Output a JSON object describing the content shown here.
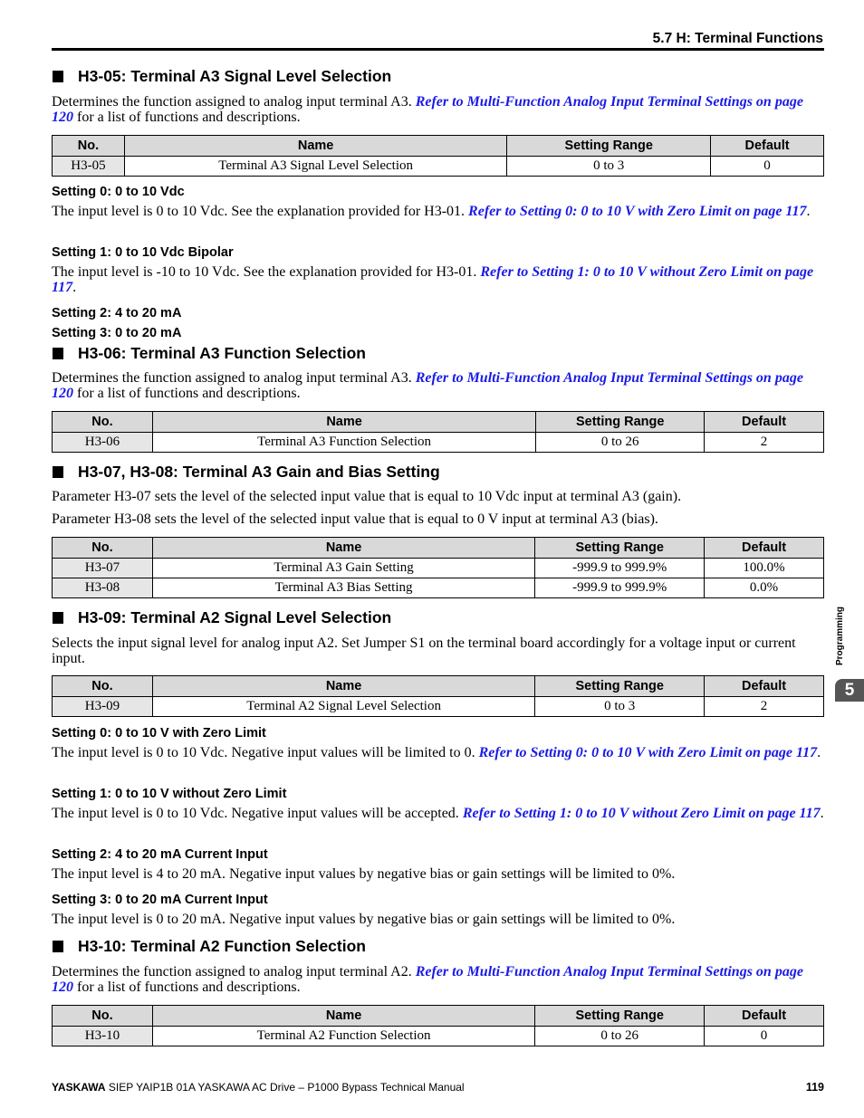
{
  "header": {
    "title": "5.7 H: Terminal Functions"
  },
  "sections": [
    {
      "heading": "H3-05: Terminal A3 Signal Level Selection",
      "intro": {
        "text_before": "Determines the function assigned to analog input terminal A3. ",
        "link": "Refer to Multi-Function Analog Input Terminal Settings on page 120",
        "text_after": " for a list of functions and descriptions."
      },
      "table": {
        "headers": [
          "No.",
          "Name",
          "Setting Range",
          "Default"
        ],
        "rows": [
          [
            "H3-05",
            "Terminal A3 Signal Level Selection",
            "0 to 3",
            "0"
          ]
        ]
      },
      "settings": [
        {
          "title": "Setting 0: 0 to 10 Vdc",
          "text_before": "The input level is 0 to 10 Vdc. See the explanation provided for H3-01. ",
          "link": "Refer to Setting 0: 0 to 10 V with Zero Limit on page 117",
          "text_after": "."
        },
        {
          "title": "Setting 1: 0 to 10 Vdc Bipolar",
          "text_before": "The input level is -10 to 10 Vdc. See the explanation provided for H3-01. ",
          "link": "Refer to Setting 1: 0 to 10 V without Zero Limit on page 117",
          "text_after": "."
        },
        {
          "title": "Setting 2: 4 to 20 mA"
        },
        {
          "title": "Setting 3: 0 to 20 mA"
        }
      ]
    },
    {
      "heading": "H3-06: Terminal A3 Function Selection",
      "intro": {
        "text_before": "Determines the function assigned to analog input terminal A3. ",
        "link": "Refer to Multi-Function Analog Input Terminal Settings on page 120",
        "text_after": " for a list of functions and descriptions."
      },
      "table": {
        "headers": [
          "No.",
          "Name",
          "Setting Range",
          "Default"
        ],
        "rows": [
          [
            "H3-06",
            "Terminal A3 Function Selection",
            "0 to 26",
            "2"
          ]
        ]
      }
    },
    {
      "heading": "H3-07, H3-08: Terminal A3 Gain and Bias Setting",
      "paragraphs": [
        "Parameter H3-07 sets the level of the selected input value that is equal to 10 Vdc input at terminal A3 (gain).",
        "Parameter H3-08 sets the level of the selected input value that is equal to 0 V input at terminal A3 (bias)."
      ],
      "table": {
        "headers": [
          "No.",
          "Name",
          "Setting Range",
          "Default"
        ],
        "rows": [
          [
            "H3-07",
            "Terminal A3 Gain Setting",
            "-999.9 to 999.9%",
            "100.0%"
          ],
          [
            "H3-08",
            "Terminal A3 Bias Setting",
            "-999.9 to 999.9%",
            "0.0%"
          ]
        ]
      }
    },
    {
      "heading": "H3-09: Terminal A2 Signal Level Selection",
      "paragraphs": [
        "Selects the input signal level for analog input A2. Set Jumper S1 on the terminal board accordingly for a voltage input or current input."
      ],
      "table": {
        "headers": [
          "No.",
          "Name",
          "Setting Range",
          "Default"
        ],
        "rows": [
          [
            "H3-09",
            "Terminal A2 Signal Level Selection",
            "0 to 3",
            "2"
          ]
        ]
      },
      "settings": [
        {
          "title": "Setting 0: 0 to 10 V with Zero Limit",
          "text_before": "The input level is 0 to 10 Vdc. Negative input values will be limited to 0. ",
          "link": "Refer to Setting 0: 0 to 10 V with Zero Limit on page 117",
          "text_after": "."
        },
        {
          "title": "Setting 1: 0 to 10 V without Zero Limit",
          "text_before": "The input level is 0 to 10 Vdc. Negative input values will be accepted. ",
          "link": "Refer to Setting 1: 0 to 10 V without Zero Limit on page 117",
          "text_after": "."
        },
        {
          "title": "Setting 2: 4 to 20 mA Current Input",
          "text_before": "The input level is 4 to 20 mA. Negative input values by negative bias or gain settings will be limited to 0%."
        },
        {
          "title": "Setting 3: 0 to 20 mA Current Input",
          "text_before": "The input level is 0 to 20 mA. Negative input values by negative bias or gain settings will be limited to 0%."
        }
      ]
    },
    {
      "heading": "H3-10: Terminal A2 Function Selection",
      "intro": {
        "text_before": "Determines the function assigned to analog input terminal A2. ",
        "link": "Refer to Multi-Function Analog Input Terminal Settings on page 120",
        "text_after": " for a list of functions and descriptions."
      },
      "table": {
        "headers": [
          "No.",
          "Name",
          "Setting Range",
          "Default"
        ],
        "rows": [
          [
            "H3-10",
            "Terminal A2 Function Selection",
            "0 to 26",
            "0"
          ]
        ]
      }
    }
  ],
  "side_tab": {
    "label": "Programming",
    "chapter": "5"
  },
  "footer": {
    "brand": "YASKAWA",
    "doc_title": " SIEP YAIP1B 01A YASKAWA AC Drive – P1000 Bypass Technical Manual",
    "page_number": "119"
  },
  "colors": {
    "link": "#1a1ae6",
    "table_header_bg": "#d9d9d9",
    "chapter_tab_bg": "#555555"
  }
}
